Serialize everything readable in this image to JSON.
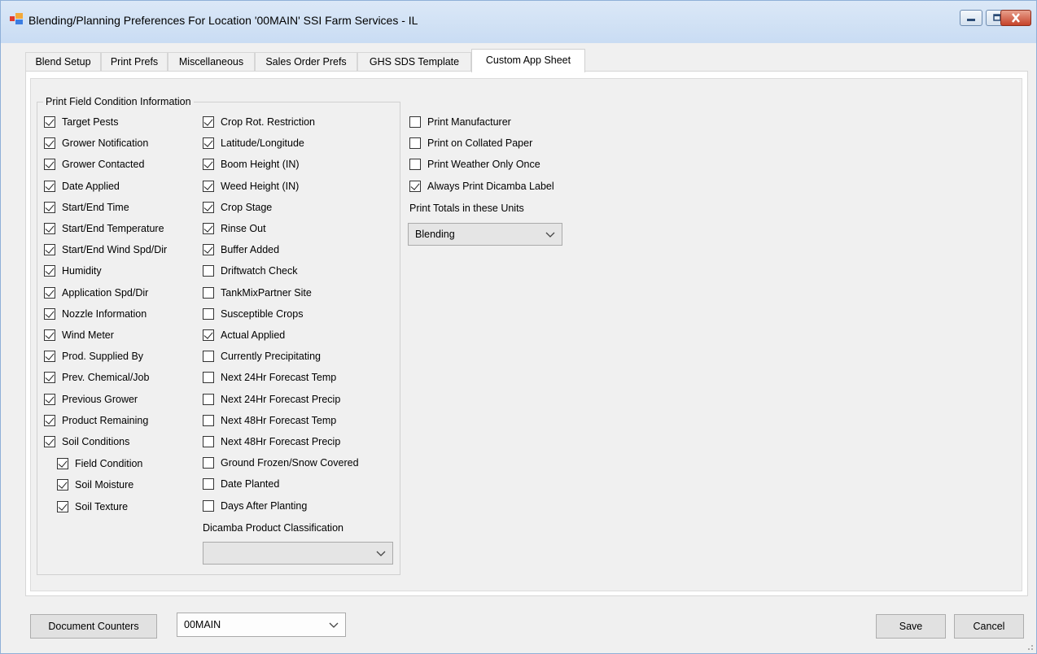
{
  "window": {
    "title": "Blending/Planning Preferences For Location '00MAIN' SSI Farm Services - IL",
    "icon": "app-icon"
  },
  "tabs": [
    {
      "label": "Blend Setup",
      "active": false
    },
    {
      "label": "Print Prefs",
      "active": false
    },
    {
      "label": "Miscellaneous",
      "active": false
    },
    {
      "label": "Sales Order Prefs",
      "active": false
    },
    {
      "label": "GHS SDS Template",
      "active": false
    },
    {
      "label": "Custom App Sheet",
      "active": true
    }
  ],
  "group": {
    "title": "Print Field Condition Information",
    "col1": [
      {
        "label": "Target Pests",
        "checked": true
      },
      {
        "label": "Grower Notification",
        "checked": true
      },
      {
        "label": "Grower Contacted",
        "checked": true
      },
      {
        "label": "Date Applied",
        "checked": true
      },
      {
        "label": "Start/End Time",
        "checked": true
      },
      {
        "label": "Start/End Temperature",
        "checked": true
      },
      {
        "label": "Start/End Wind Spd/Dir",
        "checked": true
      },
      {
        "label": "Humidity",
        "checked": true
      },
      {
        "label": "Application Spd/Dir",
        "checked": true
      },
      {
        "label": "Nozzle Information",
        "checked": true
      },
      {
        "label": "Wind Meter",
        "checked": true
      },
      {
        "label": "Prod. Supplied By",
        "checked": true
      },
      {
        "label": "Prev. Chemical/Job",
        "checked": true
      },
      {
        "label": "Previous Grower",
        "checked": true
      },
      {
        "label": "Product Remaining",
        "checked": true
      },
      {
        "label": "Soil Conditions",
        "checked": true
      }
    ],
    "col1_sub": [
      {
        "label": "Field Condition",
        "checked": true
      },
      {
        "label": "Soil Moisture",
        "checked": true
      },
      {
        "label": "Soil Texture",
        "checked": true
      }
    ],
    "col2": [
      {
        "label": "Crop Rot. Restriction",
        "checked": true
      },
      {
        "label": "Latitude/Longitude",
        "checked": true
      },
      {
        "label": "Boom Height (IN)",
        "checked": true
      },
      {
        "label": "Weed Height (IN)",
        "checked": true
      },
      {
        "label": "Crop Stage",
        "checked": true
      },
      {
        "label": "Rinse Out",
        "checked": true
      },
      {
        "label": "Buffer Added",
        "checked": true
      },
      {
        "label": "Driftwatch Check",
        "checked": false
      },
      {
        "label": "TankMixPartner Site",
        "checked": false
      },
      {
        "label": "Susceptible Crops",
        "checked": false
      },
      {
        "label": "Actual Applied",
        "checked": true
      },
      {
        "label": "Currently Precipitating",
        "checked": false
      },
      {
        "label": "Next 24Hr Forecast Temp",
        "checked": false
      },
      {
        "label": "Next 24Hr Forecast Precip",
        "checked": false
      },
      {
        "label": "Next 48Hr Forecast Temp",
        "checked": false
      },
      {
        "label": "Next 48Hr Forecast Precip",
        "checked": false
      },
      {
        "label": "Ground Frozen/Snow Covered",
        "checked": false
      },
      {
        "label": "Date Planted",
        "checked": false
      },
      {
        "label": "Days After Planting",
        "checked": false
      }
    ],
    "dicamba_label": "Dicamba Product Classification",
    "dicamba_value": ""
  },
  "right": {
    "checks": [
      {
        "label": "Print Manufacturer",
        "checked": false
      },
      {
        "label": "Print on Collated Paper",
        "checked": false
      },
      {
        "label": "Print Weather Only Once",
        "checked": false
      },
      {
        "label": "Always Print Dicamba Label",
        "checked": true
      }
    ],
    "units_label": "Print Totals in these Units",
    "units_value": "Blending"
  },
  "footer": {
    "document_counters": "Document Counters",
    "location_value": "00MAIN",
    "save": "Save",
    "cancel": "Cancel"
  }
}
